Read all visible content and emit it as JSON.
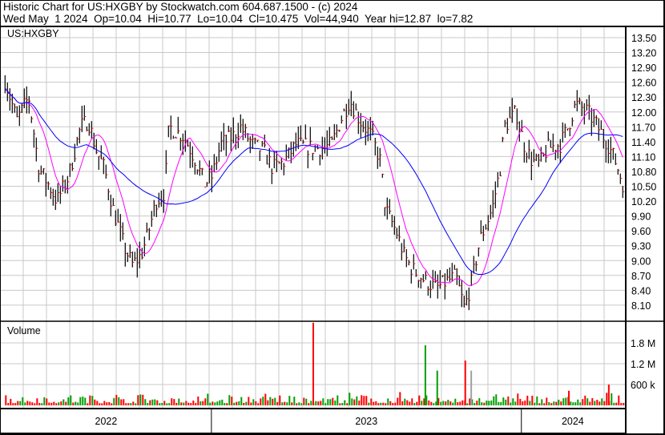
{
  "header": {
    "title": "Historic Chart for US:HXGBY by Stockwatch.com 604.687.1500 - (c) 2024",
    "quote": "Wed May  1 2024  Op=10.04  Hi=10.77  Lo=10.04  Cl=10.475  Vol=44,940  Year hi=12.87  lo=7.82"
  },
  "chart_data": {
    "type": "ohlc",
    "symbol_label": "US:HXGBY",
    "volume_label": "Volume",
    "x_range": [
      "2022-04-28",
      "2024-05-01"
    ],
    "price_ylim": [
      7.82,
      13.6
    ],
    "price_ticks": [
      "13.50",
      "13.20",
      "12.90",
      "12.60",
      "12.30",
      "12.00",
      "11.70",
      "11.40",
      "11.10",
      "10.80",
      "10.50",
      "10.20",
      "9.90",
      "9.60",
      "9.30",
      "9.00",
      "8.70",
      "8.40",
      "8.10"
    ],
    "volume_ticks": [
      {
        "label": "1.8 M",
        "value": 1800000
      },
      {
        "label": "1.2 M",
        "value": 1200000
      },
      {
        "label": "600 k",
        "value": 600000
      }
    ],
    "x_tick_labels": [
      {
        "label": "2022",
        "from": "2022-04-28",
        "to": "2023-01-01"
      },
      {
        "label": "2023",
        "from": "2023-01-01",
        "to": "2024-01-01"
      },
      {
        "label": "2024",
        "from": "2024-01-01",
        "to": "2024-05-01"
      }
    ],
    "grid": true,
    "colors": {
      "bars": "#000000",
      "close_tick": "#ff0000",
      "ma_short": "#ff00ff",
      "ma_long": "#0000ff",
      "vol_up": "#00a000",
      "vol_down": "#ff0000",
      "vol_flat": "#a0a0a0",
      "grid": "#c8c8c8"
    },
    "approx_closes": [
      [
        "2022-05-03",
        12.64
      ],
      [
        "2022-05-17",
        11.83
      ],
      [
        "2022-05-31",
        12.3
      ],
      [
        "2022-06-12",
        10.86
      ],
      [
        "2022-06-23",
        10.54
      ],
      [
        "2022-07-03",
        10.2
      ],
      [
        "2022-07-17",
        10.7
      ],
      [
        "2022-07-31",
        11.7
      ],
      [
        "2022-08-09",
        11.83
      ],
      [
        "2022-08-19",
        11.2
      ],
      [
        "2022-08-28",
        10.86
      ],
      [
        "2022-09-07",
        10.06
      ],
      [
        "2022-09-21",
        9.25
      ],
      [
        "2022-09-30",
        8.92
      ],
      [
        "2022-10-10",
        9.1
      ],
      [
        "2022-10-19",
        9.57
      ],
      [
        "2022-10-28",
        10.2
      ],
      [
        "2022-11-07",
        10.38
      ],
      [
        "2022-11-12",
        11.7
      ],
      [
        "2022-11-30",
        11.5
      ],
      [
        "2022-12-14",
        11.0
      ],
      [
        "2022-12-24",
        10.54
      ],
      [
        "2023-01-02",
        10.7
      ],
      [
        "2023-01-12",
        11.35
      ],
      [
        "2023-01-26",
        11.5
      ],
      [
        "2023-02-04",
        11.7
      ],
      [
        "2023-02-18",
        11.35
      ],
      [
        "2023-03-04",
        11.2
      ],
      [
        "2023-03-14",
        10.86
      ],
      [
        "2023-03-28",
        11.0
      ],
      [
        "2023-04-11",
        11.35
      ],
      [
        "2023-04-30",
        11.27
      ],
      [
        "2023-05-14",
        11.27
      ],
      [
        "2023-05-23",
        11.35
      ],
      [
        "2023-06-02",
        11.83
      ],
      [
        "2023-06-13",
        12.24
      ],
      [
        "2023-06-25",
        11.83
      ],
      [
        "2023-07-09",
        11.5
      ],
      [
        "2023-07-19",
        11.0
      ],
      [
        "2023-07-25",
        10.05
      ],
      [
        "2023-08-07",
        9.57
      ],
      [
        "2023-08-16",
        9.1
      ],
      [
        "2023-08-25",
        8.84
      ],
      [
        "2023-09-09",
        8.6
      ],
      [
        "2023-09-23",
        8.44
      ],
      [
        "2023-10-07",
        8.6
      ],
      [
        "2023-10-16",
        8.68
      ],
      [
        "2023-10-26",
        8.03
      ],
      [
        "2023-11-04",
        8.6
      ],
      [
        "2023-11-13",
        9.4
      ],
      [
        "2023-11-28",
        10.06
      ],
      [
        "2023-12-07",
        10.86
      ],
      [
        "2023-12-12",
        11.7
      ],
      [
        "2023-12-26",
        12.0
      ],
      [
        "2024-01-04",
        11.35
      ],
      [
        "2024-01-14",
        11.0
      ],
      [
        "2024-01-23",
        10.95
      ],
      [
        "2024-02-01",
        11.27
      ],
      [
        "2024-02-16",
        11.35
      ],
      [
        "2024-02-25",
        11.7
      ],
      [
        "2024-03-05",
        12.16
      ],
      [
        "2024-03-19",
        12.0
      ],
      [
        "2024-03-29",
        11.75
      ],
      [
        "2024-04-12",
        11.35
      ],
      [
        "2024-04-21",
        11.0
      ],
      [
        "2024-05-01",
        10.475
      ]
    ],
    "volume_spikes": [
      [
        "2023-04-30",
        2380000,
        "down"
      ],
      [
        "2023-09-09",
        1730000,
        "up"
      ],
      [
        "2023-09-23",
        1000000,
        "up"
      ],
      [
        "2023-10-26",
        1290000,
        "down"
      ],
      [
        "2023-11-02",
        1000000,
        "flat"
      ],
      [
        "2024-02-25",
        420000,
        "down"
      ],
      [
        "2024-04-12",
        600000,
        "down"
      ]
    ]
  }
}
